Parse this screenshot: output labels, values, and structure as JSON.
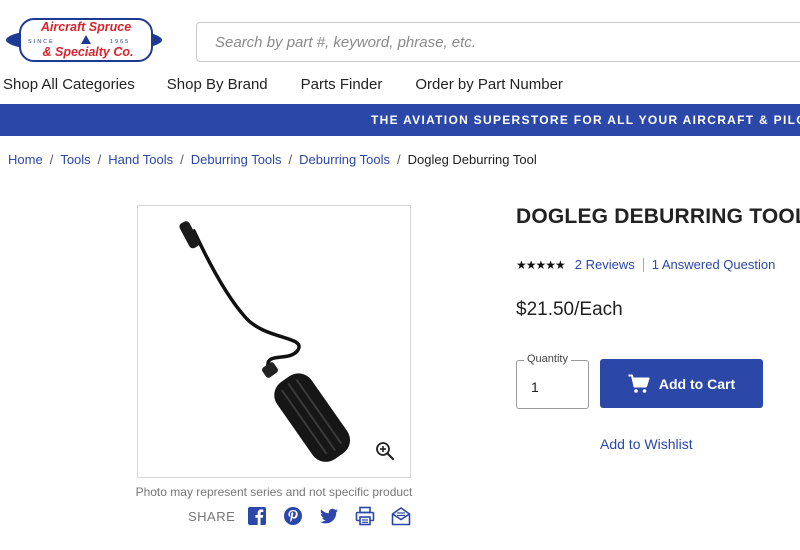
{
  "header": {
    "logo": {
      "line1": "Aircraft Spruce",
      "line2": "& Specialty Co.",
      "since_left": "SINCE",
      "since_right": "1965"
    },
    "search": {
      "placeholder": "Search by part #, keyword, phrase, etc."
    }
  },
  "nav": {
    "items": [
      {
        "label": "Shop All Categories"
      },
      {
        "label": "Shop By Brand"
      },
      {
        "label": "Parts Finder"
      },
      {
        "label": "Order by Part Number"
      }
    ]
  },
  "banner": {
    "text": "THE AVIATION SUPERSTORE FOR ALL YOUR AIRCRAFT & PILOT NEEDS"
  },
  "breadcrumb": {
    "items": [
      {
        "label": "Home"
      },
      {
        "label": "Tools"
      },
      {
        "label": "Hand Tools"
      },
      {
        "label": "Deburring Tools"
      },
      {
        "label": "Deburring Tools"
      }
    ],
    "current": "Dogleg Deburring Tool"
  },
  "product": {
    "title": "DOGLEG DEBURRING TOOL",
    "stars": "★★★★★",
    "rating_value": 5,
    "reviews_link": "2 Reviews",
    "questions_link": "1 Answered Question",
    "price": "$21.50/Each",
    "quantity_label": "Quantity",
    "quantity_value": "1",
    "add_to_cart": "Add to Cart",
    "wishlist": "Add to Wishlist",
    "image_caption": "Photo may represent series and not specific product",
    "share_label": "SHARE",
    "share_icons": [
      "facebook-icon",
      "pinterest-icon",
      "twitter-icon",
      "print-icon",
      "email-icon"
    ]
  },
  "colors": {
    "brand_blue": "#2b47a8",
    "logo_red": "#d9232e",
    "text": "#222222",
    "muted": "#777777"
  }
}
